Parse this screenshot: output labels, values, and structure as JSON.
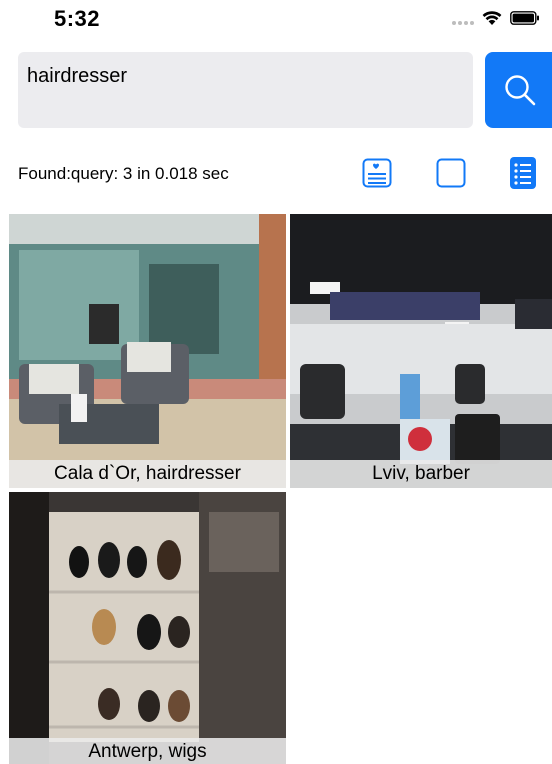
{
  "status_bar": {
    "time": "5:32"
  },
  "search": {
    "value": "hairdresser",
    "button_icon": "search-icon",
    "accent_color": "#1279f7"
  },
  "results": {
    "summary": "Found:query: 3 in 0.018 sec"
  },
  "view_modes": [
    {
      "name": "card-view",
      "icon": "card-view-icon"
    },
    {
      "name": "grid-view",
      "icon": "grid-view-icon"
    },
    {
      "name": "list-view",
      "icon": "list-view-icon",
      "selected": true
    }
  ],
  "photos": [
    {
      "caption": "Cala d`Or, hairdresser"
    },
    {
      "caption": "Lviv, barber"
    },
    {
      "caption": "Antwerp, wigs"
    }
  ]
}
